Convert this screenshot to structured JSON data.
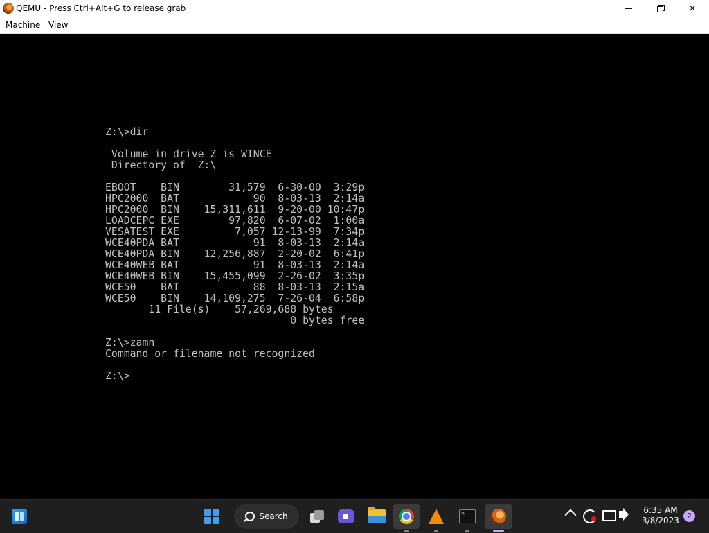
{
  "window": {
    "title": "QEMU - Press Ctrl+Alt+G to release grab"
  },
  "menubar": {
    "items": [
      "Machine",
      "View"
    ]
  },
  "console": {
    "lines": [
      "Z:\\>dir",
      "",
      " Volume in drive Z is WINCE",
      " Directory of  Z:\\",
      "",
      "EBOOT    BIN        31,579  6-30-00  3:29p",
      "HPC2000  BAT            90  8-03-13  2:14a",
      "HPC2000  BIN    15,311,611  9-20-00 10:47p",
      "LOADCEPC EXE        97,820  6-07-02  1:00a",
      "VESATEST EXE         7,057 12-13-99  7:34p",
      "WCE40PDA BAT            91  8-03-13  2:14a",
      "WCE40PDA BIN    12,256,887  2-20-02  6:41p",
      "WCE40WEB BAT            91  8-03-13  2:14a",
      "WCE40WEB BIN    15,455,099  2-26-02  3:35p",
      "WCE50    BAT            88  8-03-13  2:15a",
      "WCE50    BIN    14,109,275  7-26-04  6:58p",
      "       11 File(s)    57,269,688 bytes",
      "                              0 bytes free",
      "",
      "Z:\\>zamn",
      "Command or filename not recognized",
      "",
      "Z:\\>"
    ]
  },
  "taskbar": {
    "search_label": "Search",
    "clock_time": "6:35 AM",
    "clock_date": "3/8/2023",
    "notification_count": "2"
  },
  "colors": {
    "console_fg": "#c0c0c0",
    "console_bg": "#000000",
    "taskbar_bg": "#1f1f1f",
    "accent": "#c9a6ff"
  }
}
